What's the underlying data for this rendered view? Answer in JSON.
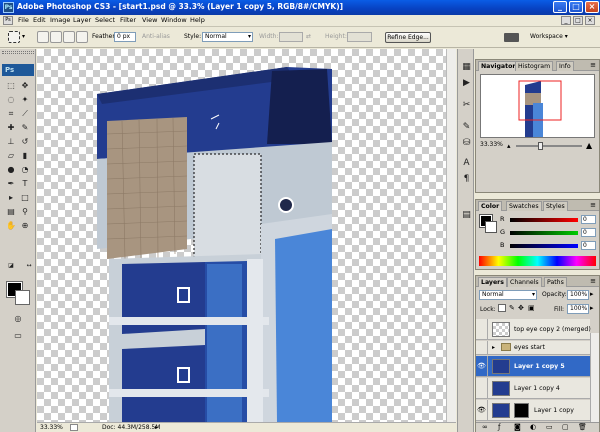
{
  "app": {
    "title": "Adobe Photoshop CS3 - [start1.psd @ 33.3% (Layer 1 copy 5, RGB/8#/CMYK)]",
    "icon_text": "Ps",
    "logo_text": "Ps"
  },
  "menu": {
    "items": [
      "File",
      "Edit",
      "Image",
      "Layer",
      "Select",
      "Filter",
      "View",
      "Window",
      "Help"
    ],
    "doc_buttons": [
      "_",
      "□",
      "×"
    ]
  },
  "options": {
    "feather_label": "Feather:",
    "feather_value": "0 px",
    "antialias_label": "Anti-alias",
    "style_label": "Style:",
    "style_value": "Normal",
    "width_label": "Width:",
    "height_label": "Height:",
    "refine_edge": "Refine Edge...",
    "workspace": "Workspace ▾"
  },
  "status": {
    "zoom": "33.33%",
    "doc": "Doc: 44.3M/258.5M"
  },
  "navigator": {
    "tabs": [
      "Navigator",
      "Histogram",
      "Info"
    ],
    "zoom": "33.33%"
  },
  "color_panel": {
    "tabs": [
      "Color",
      "Swatches",
      "Styles"
    ],
    "channels": [
      {
        "label": "R",
        "value": "0",
        "color": "#d00000"
      },
      {
        "label": "G",
        "value": "0",
        "color": "#00a000"
      },
      {
        "label": "B",
        "value": "0",
        "color": "#0000d0"
      }
    ]
  },
  "layers_panel": {
    "tabs": [
      "Layers",
      "Channels",
      "Paths"
    ],
    "blend_mode": "Normal",
    "opacity_label": "Opacity:",
    "opacity_value": "100%",
    "lock_label": "Lock:",
    "fill_label": "Fill:",
    "fill_value": "100%",
    "layers": [
      {
        "name": "top eye copy 2 (merged)",
        "visible": false,
        "selected": false
      },
      {
        "name": "eyes start",
        "visible": false,
        "selected": false
      },
      {
        "name": "Layer 1 copy 5",
        "visible": true,
        "selected": true
      },
      {
        "name": "Layer 1 copy 4",
        "visible": false,
        "selected": false
      },
      {
        "name": "Layer 1 copy",
        "visible": true,
        "selected": false
      }
    ]
  },
  "colors": {
    "titlebar": "#0843c4",
    "selected_layer": "#3169c6",
    "building_blue": "#233c8f"
  }
}
